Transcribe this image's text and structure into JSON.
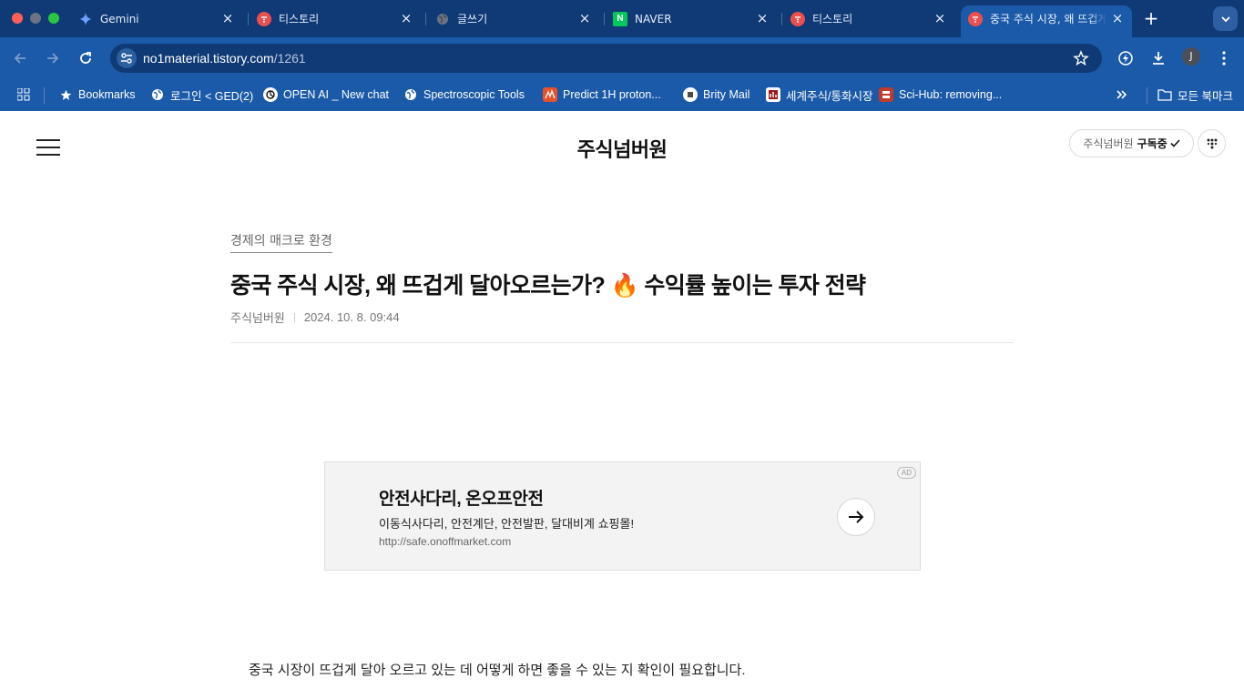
{
  "browser": {
    "tabs": [
      {
        "title": "Gemini",
        "favicon": "gemini-icon",
        "active": false
      },
      {
        "title": "티스토리",
        "favicon": "tistory-icon",
        "active": false
      },
      {
        "title": "글쓰기",
        "favicon": "globe-icon",
        "active": false
      },
      {
        "title": "NAVER",
        "favicon": "naver-icon",
        "active": false
      },
      {
        "title": "티스토리",
        "favicon": "tistory-icon",
        "active": false
      },
      {
        "title": "중국 주식 시장, 왜 뜨겁게",
        "favicon": "tistory-icon",
        "active": true
      }
    ],
    "url_host": "no1material.tistory.com",
    "url_path": "/1261",
    "profile_initial": "J",
    "bookmarks": [
      {
        "label": "Bookmarks",
        "icon": "star-icon"
      },
      {
        "label": "로그인 < GED(2)",
        "icon": "globe-icon"
      },
      {
        "label": "OPEN AI _ New chat",
        "icon": "openai-icon"
      },
      {
        "label": "Spectroscopic Tools",
        "icon": "globe-icon"
      },
      {
        "label": "Predict 1H proton...",
        "icon": "nmr-icon"
      },
      {
        "label": "Brity Mail",
        "icon": "brity-icon"
      },
      {
        "label": "세계주식/통화시장",
        "icon": "finance-icon"
      },
      {
        "label": "Sci-Hub: removing...",
        "icon": "scihub-icon"
      }
    ],
    "all_bookmarks_label": "모든 북마크"
  },
  "blog": {
    "title": "주식넘버원",
    "subscribe_name": "주식넘버원",
    "subscribe_state": "구독중"
  },
  "post": {
    "category": "경제의 매크로 환경",
    "title": "중국 주식 시장, 왜 뜨겁게 달아오르는가? 🔥 수익률 높이는 투자 전략",
    "author": "주식넘버원",
    "date": "2024. 10. 8. 09:44",
    "first_paragraph": "중국 시장이 뜨겁게 달아 오르고 있는 데 어떻게 하면 좋을 수 있는 지 확인이 필요합니다."
  },
  "ad": {
    "badge": "AD",
    "title": "안전사다리, 온오프안전",
    "description": "이동식사다리, 안전계단, 안전발판, 달대비계 쇼핑몰!",
    "url": "http://safe.onoffmarket.com"
  },
  "colors": {
    "chrome_dark": "#0f3a75",
    "chrome": "#1b5aa8",
    "tistory_red": "#eb4f4f",
    "naver_green": "#03c75a"
  }
}
